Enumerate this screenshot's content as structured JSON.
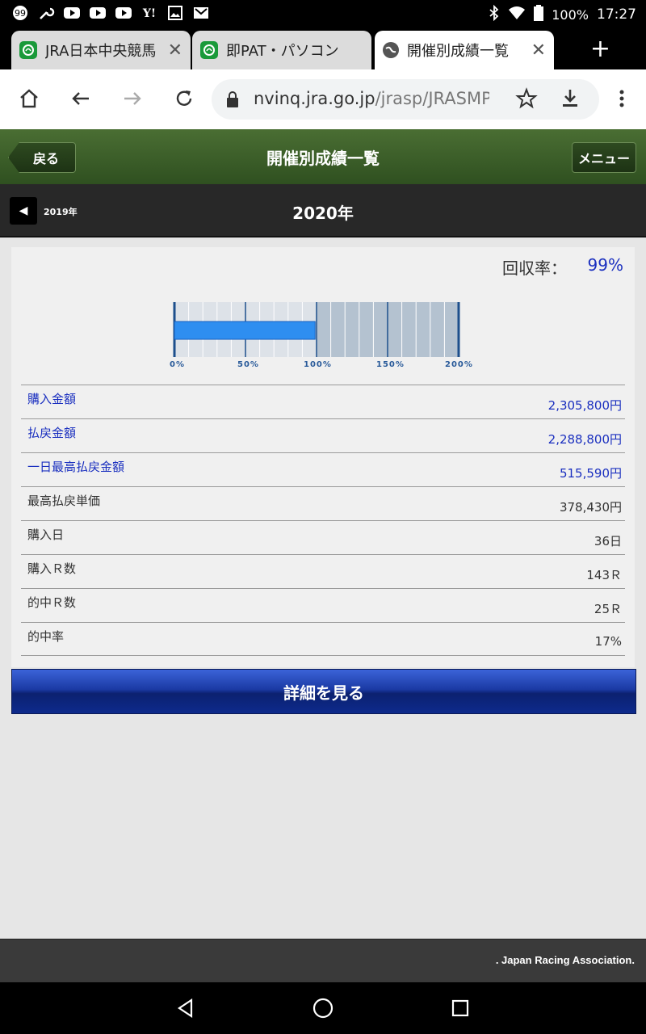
{
  "status_bar": {
    "battery": "100%",
    "time": "17:27",
    "icons": [
      "quote-icon",
      "wrench-icon",
      "youtube-icon",
      "youtube-icon",
      "youtube-icon",
      "yahoo-icon",
      "image-icon",
      "gmail-icon"
    ]
  },
  "tabs": [
    {
      "title": "JRA日本中央競馬",
      "favicon": "jra-icon",
      "active": false
    },
    {
      "title": "即PAT・パソコン",
      "favicon": "jra-icon",
      "active": false
    },
    {
      "title": "開催別成績一覧",
      "favicon": "globe-icon",
      "active": true
    }
  ],
  "address_bar": {
    "host": "nvinq.jra.go.jp",
    "path": "/jrasp/JRASMP("
  },
  "header": {
    "back_label": "戻る",
    "title": "開催別成績一覧",
    "menu_label": "メニュー"
  },
  "year_nav": {
    "prev_year": "2019年",
    "current_year": "2020年"
  },
  "recovery": {
    "label": "回収率：",
    "value": "99%",
    "fraction_of_max": 0.495
  },
  "gauge": {
    "tick_labels": [
      "0%",
      "50%",
      "100%",
      "150%",
      "200%"
    ],
    "fill_color": "#2e8ef0"
  },
  "rows": [
    {
      "label": "購入金額",
      "value": "2,305,800円",
      "link": true
    },
    {
      "label": "払戻金額",
      "value": "2,288,800円",
      "link": true
    },
    {
      "label": "一日最高払戻金額",
      "value": "515,590円",
      "link": true
    },
    {
      "label": "最高払戻単価",
      "value": "378,430円",
      "link": false
    },
    {
      "label": "購入日",
      "value": "36日",
      "link": false
    },
    {
      "label": "購入Ｒ数",
      "value": "143Ｒ",
      "link": false
    },
    {
      "label": "的中Ｒ数",
      "value": "25Ｒ",
      "link": false
    },
    {
      "label": "的中率",
      "value": "17%",
      "link": false
    }
  ],
  "detail_button": "詳細を見る",
  "footer": ". Japan Racing Association."
}
